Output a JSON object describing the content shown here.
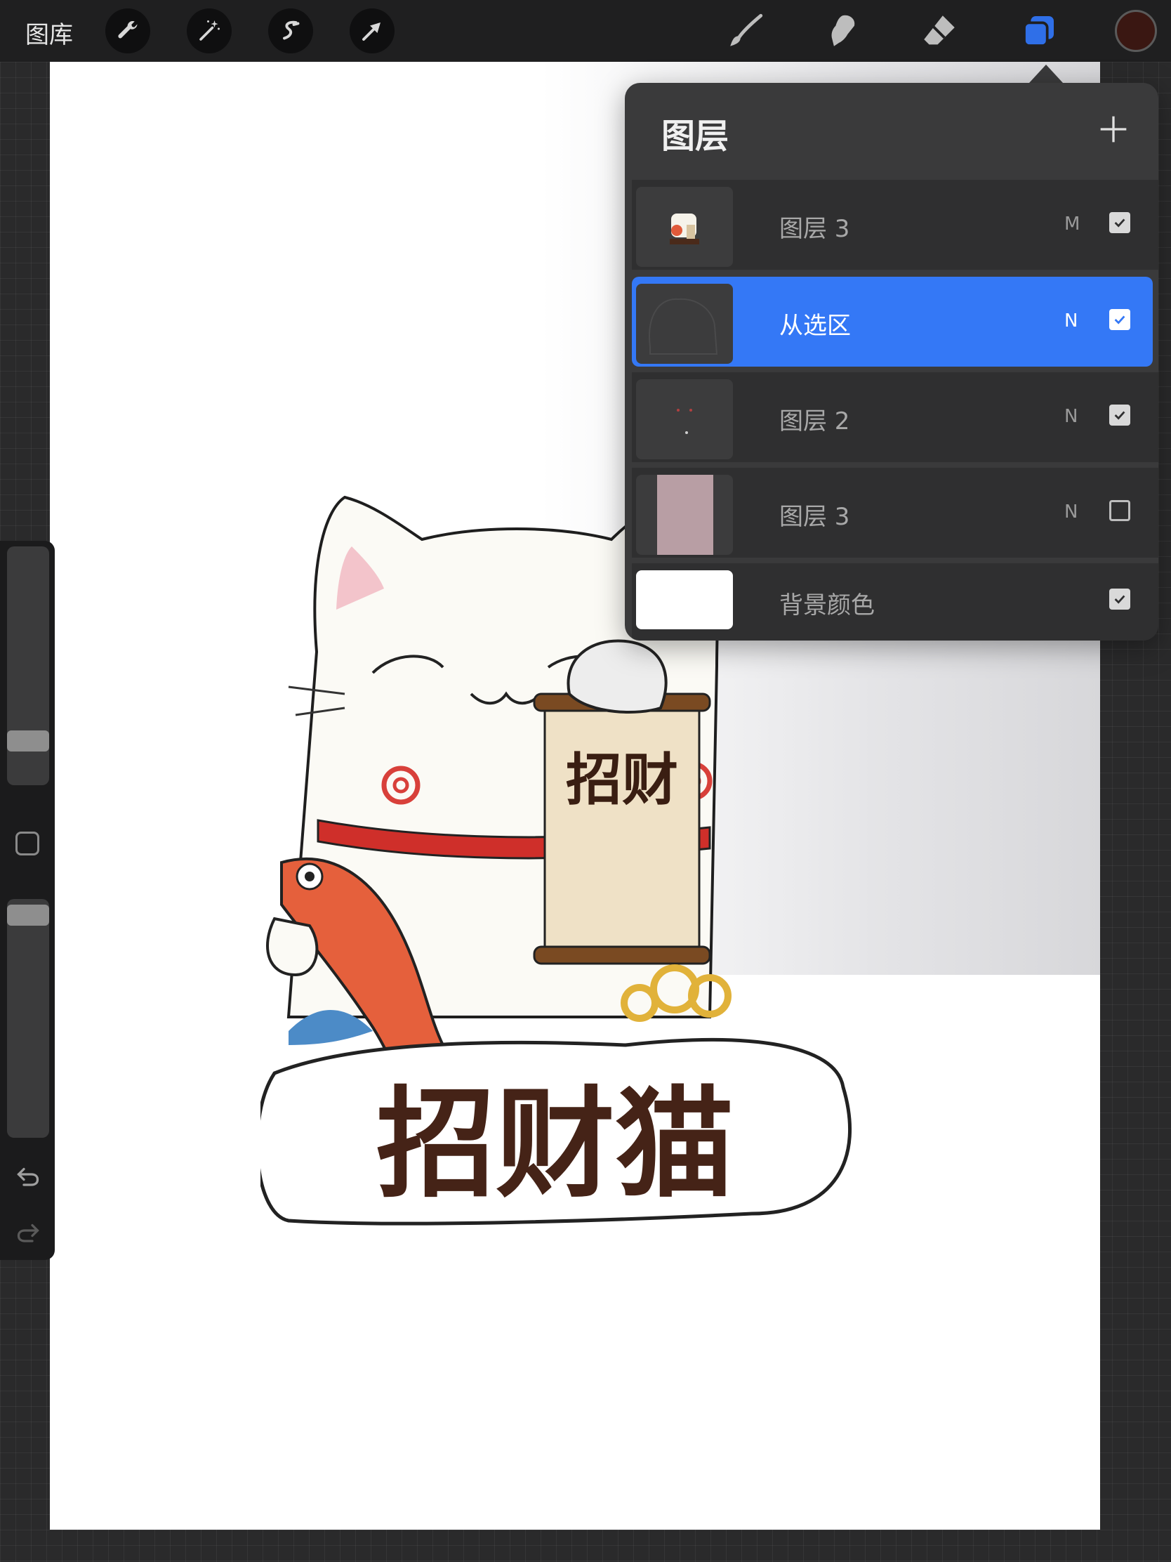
{
  "toolbar": {
    "gallery_label": "图库",
    "left_tools": [
      "wrench-icon",
      "magic-wand-icon",
      "selection-s-icon",
      "move-arrow-icon"
    ],
    "right_tools": [
      "brush-icon",
      "smudge-icon",
      "eraser-icon",
      "layers-icon"
    ],
    "current_color": "#3a1712",
    "active_tool_color": "#2f6fe8"
  },
  "sidebar": {
    "brush_size_level": 0.33,
    "brush_opacity_level": 0.94,
    "undo": "undo-icon",
    "redo": "redo-icon"
  },
  "layers_panel": {
    "title": "图层",
    "add": "plus-icon",
    "layers": [
      {
        "name": "图层 3",
        "blend": "M",
        "visible": true,
        "active": false
      },
      {
        "name": "从选区",
        "blend": "N",
        "visible": true,
        "active": true
      },
      {
        "name": "图层 2",
        "blend": "N",
        "visible": true,
        "active": false
      },
      {
        "name": "图层 3",
        "blend": "N",
        "visible": false,
        "active": false
      },
      {
        "name": "背景颜色",
        "blend": "",
        "visible": true,
        "active": false
      }
    ]
  },
  "artwork": {
    "scroll_text": "招财",
    "banner_text": "招财猫"
  },
  "colors": {
    "selection_blue": "#3478f6",
    "panel_bg": "#3a3a3b",
    "layer_swatch": "#b89ea4"
  }
}
